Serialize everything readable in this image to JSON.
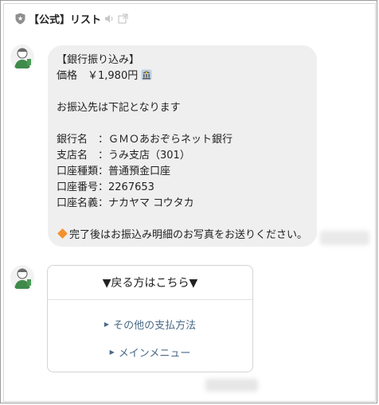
{
  "header": {
    "title": "【公式】リスト",
    "icons": [
      "shield-icon",
      "speaker-icon",
      "popout-icon"
    ]
  },
  "message": {
    "title": "【銀行振り込み】",
    "price_label": "価格　￥1,980円",
    "intro": "お振込先は下記となります",
    "bank_name": "銀行名　：ＧＭＯあおぞらネット銀行",
    "branch": "支店名　：うみ支店（301）",
    "account_type": "口座種類：普通預金口座",
    "account_number": "口座番号：2267653",
    "account_holder": "口座名義：ナカヤマ コウタカ",
    "closing": "完了後はお振込み明細のお写真をお送りください。",
    "icons": [
      "bank-icon",
      "diamond-icon"
    ]
  },
  "menu_card": {
    "title": "▼戻る方はこちら▼",
    "links": [
      {
        "label": "その他の支払方法"
      },
      {
        "label": "メインメニュー"
      }
    ]
  },
  "colors": {
    "bubble_bg": "#efefef",
    "link": "#4a6a87",
    "accent_diamond": "#f2912d"
  }
}
